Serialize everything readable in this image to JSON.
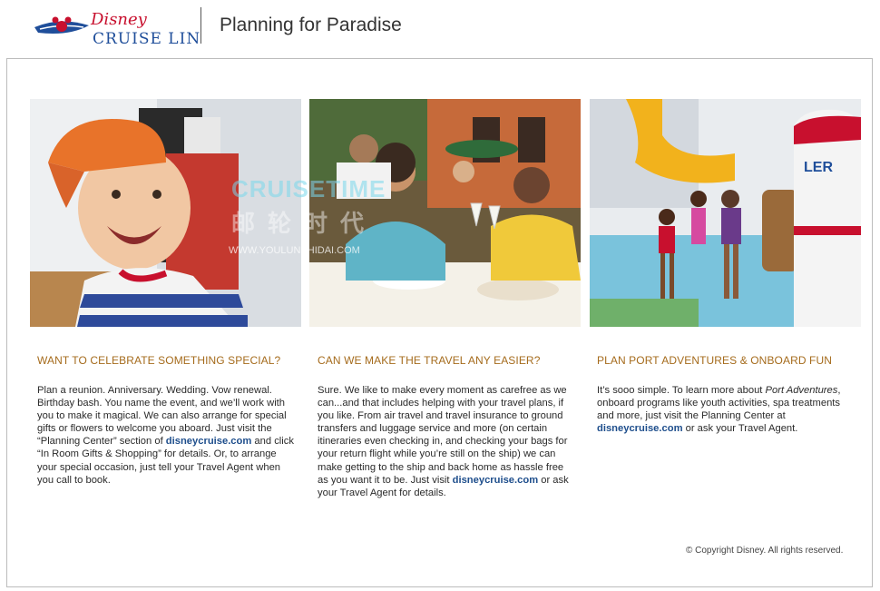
{
  "header": {
    "logo_top": "Disney",
    "logo_bottom": "CRUISE LINE",
    "title": "Planning for Paradise"
  },
  "watermark": {
    "line1": "CRUISETIME",
    "line2": "邮轮时代",
    "line3": "WWW.YOULUNSHIDAI.COM"
  },
  "columns": [
    {
      "heading": "WANT TO CELEBRATE SOMETHING SPECIAL?",
      "text_a": "Plan a reunion. Anniversary. Wedding. Vow renewal. Birthday bash. You name the event, and we’ll work with you to make it magical. We can also arrange for special gifts or flowers to welcome you aboard. Just visit the “Planning Center” section of ",
      "link": "disneycruise.com",
      "text_b": " and click “In Room Gifts & Shopping” for details. Or, to arrange your special occasion, just tell your Travel Agent when you call to book."
    },
    {
      "heading": "CAN WE MAKE THE TRAVEL ANY EASIER?",
      "text_a": "Sure. We like to make every moment as carefree as we can...and that includes helping with your travel plans, if you like. From air travel and travel insurance to ground transfers and luggage service and more (on certain itineraries even checking in, and checking your bags for your return flight while you’re still on the ship) we can make getting to the ship and back home as hassle free as you want it to be. Just visit ",
      "link": "disneycruise.com",
      "text_b": " or ask your Travel Agent for details."
    },
    {
      "heading": "PLAN PORT ADVENTURES & ONBOARD FUN",
      "text_a": "It’s sooo simple. To learn more about ",
      "italic": "Port Adventures",
      "text_mid": ", onboard programs like youth activities, spa treatments and more, just visit the Planning Center at ",
      "link": "disneycruise.com",
      "text_b": " or ask your Travel Agent."
    }
  ],
  "copyright": "© Copyright Disney. All rights reserved.",
  "colors": {
    "heading": "#a56b1c",
    "link": "#1e4e8c",
    "logo_red": "#c8102e",
    "logo_blue": "#1f4e9a"
  }
}
